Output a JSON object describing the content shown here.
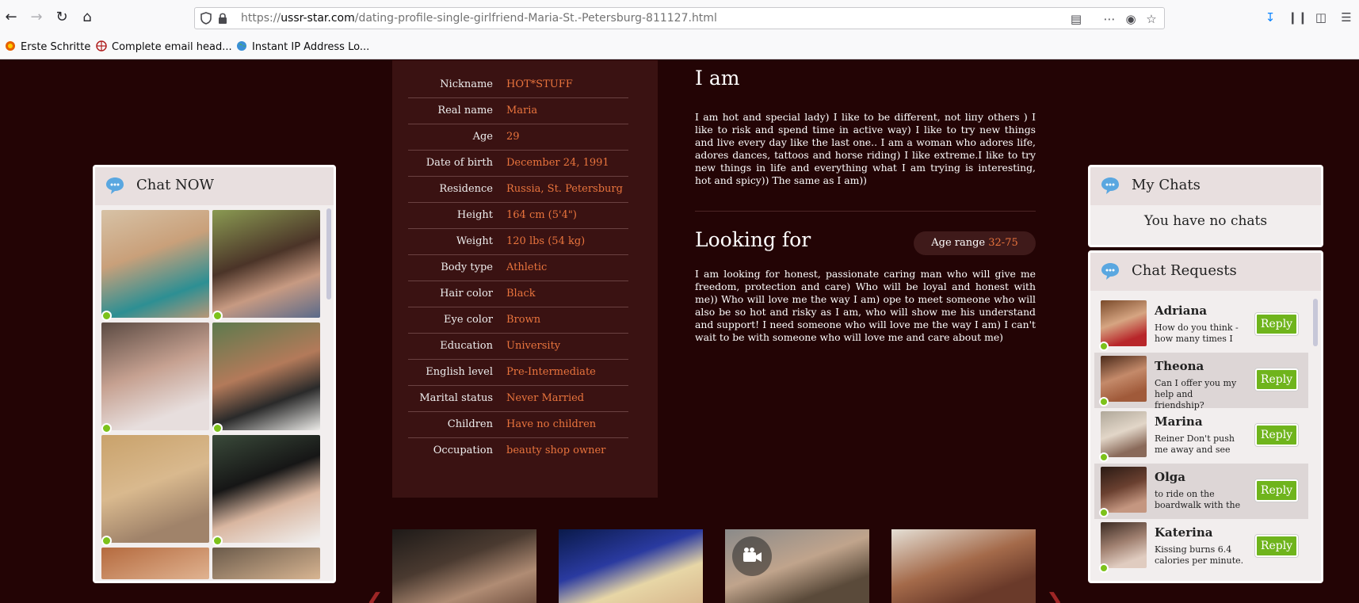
{
  "browser": {
    "url_prefix": "https://",
    "url_host": "ussr-star.com",
    "url_path": "/dating-profile-single-girlfriend-Maria-St.-Petersburg-811127.html",
    "bookmarks": [
      "Erste Schritte",
      "Complete email head...",
      "Instant IP Address Lo..."
    ]
  },
  "chat_now": {
    "title": "Chat NOW"
  },
  "my_chats": {
    "title": "My Chats",
    "empty_text": "You have no chats"
  },
  "chat_requests": {
    "title": "Chat Requests",
    "reply_label": "Reply",
    "items": [
      {
        "name": "Adriana",
        "message": "How do you think - how many times I"
      },
      {
        "name": "Theona",
        "message": "Can I offer you my help and friendship?"
      },
      {
        "name": "Marina",
        "message": "Reiner Don't push me away and see"
      },
      {
        "name": "Olga",
        "message": "to ride on the boardwalk with the"
      },
      {
        "name": "Katerina",
        "message": "Kissing burns 6.4 calories per minute."
      }
    ]
  },
  "profile": {
    "rows": [
      {
        "label": "Nickname",
        "value": "HOT*STUFF"
      },
      {
        "label": "Real name",
        "value": "Maria"
      },
      {
        "label": "Age",
        "value": "29"
      },
      {
        "label": "Date of birth",
        "value": "December 24, 1991"
      },
      {
        "label": "Residence",
        "value": "Russia, St. Petersburg"
      },
      {
        "label": "Height",
        "value": "164 cm (5'4\")"
      },
      {
        "label": "Weight",
        "value": "120 lbs (54 kg)"
      },
      {
        "label": "Body type",
        "value": "Athletic"
      },
      {
        "label": "Hair color",
        "value": "Black"
      },
      {
        "label": "Eye color",
        "value": "Brown"
      },
      {
        "label": "Education",
        "value": "University"
      },
      {
        "label": "English level",
        "value": "Pre-Intermediate"
      },
      {
        "label": "Marital status",
        "value": "Never Married"
      },
      {
        "label": "Children",
        "value": "Have no children"
      },
      {
        "label": "Occupation",
        "value": "beauty shop owner"
      }
    ],
    "i_am_title": "I am",
    "i_am_text": "I am hot and special lady) I like to be different, not liпу others ) I like to risk and spend time in active way) I like to try new things and live every day like the last one.. I am a woman who adores life, adores dances, tattoos and horse riding) I like extreme.I like to try new things in life and everything what I am trying is interesting, hot and spicy)) The same as I am))",
    "looking_for_title": "Looking for",
    "age_range_label": "Age range",
    "age_range_value": "32-75",
    "looking_for_text": "I am looking for honest, passionate caring man who will give me freedom, protection and care) Who will be loyal and honest with me)) Who will love me the way I am) ope to meet someone who will also be so hot and risky as I am, who will show me his understand and support! I need someone who will love me the way I am) I can't wait to be with someone who will love me and care about me)"
  },
  "colors": {
    "page_bg": "#230405",
    "accent": "#e9743d",
    "reply_green": "#6fb41c",
    "online": "#7dc21b"
  }
}
